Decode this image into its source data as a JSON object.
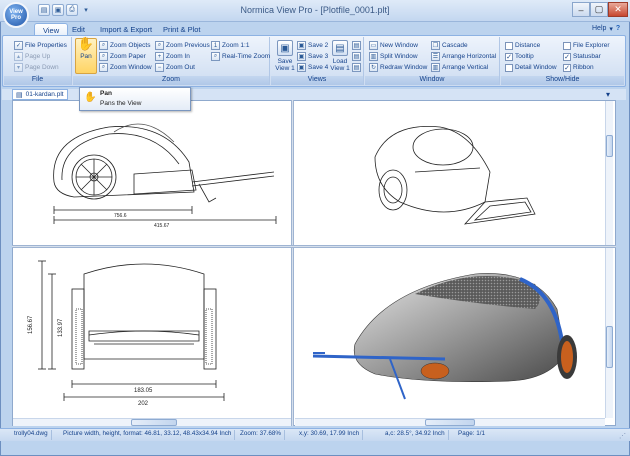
{
  "window": {
    "title": "Normica View Pro - [Plotfile_0001.plt]",
    "app_orb_label": "View Pro",
    "minimize": "–",
    "maximize": "▢",
    "close": "✕",
    "help_label": "Help"
  },
  "tabs": [
    {
      "label": "View",
      "active": true
    },
    {
      "label": "Edit",
      "active": false
    },
    {
      "label": "Import & Export",
      "active": false
    },
    {
      "label": "Print & Plot",
      "active": false
    }
  ],
  "ribbon": {
    "file": {
      "label": "File",
      "items": [
        {
          "label": "File Properties",
          "enabled": true
        },
        {
          "label": "Page Up",
          "enabled": false
        },
        {
          "label": "Page Down",
          "enabled": false
        }
      ]
    },
    "zoom": {
      "label": "Zoom",
      "pan": "Pan",
      "col1": [
        "Zoom Objects",
        "Zoom Paper",
        "Zoom Window"
      ],
      "col2": [
        "Zoom Previous",
        "Zoom In",
        "Zoom Out"
      ],
      "col3": [
        "Zoom 1:1",
        "Real-Time Zoom"
      ]
    },
    "views": {
      "label": "Views",
      "save_view": "Save View 1",
      "save_list": [
        "Save 2",
        "Save 3",
        "Save 4"
      ],
      "load_view": "Load View 1"
    },
    "window": {
      "label": "Window",
      "col1": [
        "New Window",
        "Split Window",
        "Redraw Window"
      ],
      "col2": [
        "Cascade",
        "Arrange Horizontal",
        "Arrange Vertical"
      ]
    },
    "showhide": {
      "label": "Show/Hide",
      "col1": [
        {
          "label": "Distance",
          "checked": false
        },
        {
          "label": "Tooltip",
          "checked": true
        },
        {
          "label": "Detail Window",
          "checked": false
        }
      ],
      "col2": [
        {
          "label": "File Explorer",
          "checked": false
        },
        {
          "label": "Statusbar",
          "checked": true
        },
        {
          "label": "Ribbon",
          "checked": true
        }
      ]
    }
  },
  "doc_tab": {
    "label": "01-kardan.plt",
    "close": "✕"
  },
  "tooltip": {
    "title": "Pan",
    "description": "Pans the View"
  },
  "drawing": {
    "top_left_dims": [
      "756.6",
      "415.67"
    ],
    "bottom_left_dims": [
      "183.05",
      "202",
      "156.67",
      "133.97"
    ]
  },
  "status": {
    "file": "trolly04.dwg",
    "picture": "Picture width, height, format: 46.81, 33.12, 48.43x34.94 Inch",
    "zoom": "Zoom: 37.68%",
    "xy": "x,y: 30.69, 17.99 Inch",
    "angle": "a,c: 28.5°, 34.92 Inch",
    "page": "Page: 1/1"
  }
}
